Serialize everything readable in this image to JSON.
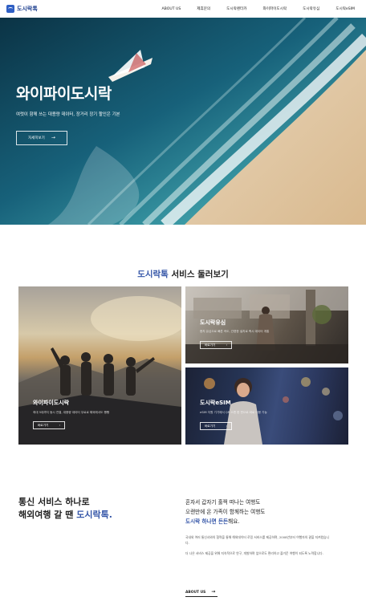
{
  "header": {
    "logo_text": "도시락톡",
    "nav": [
      "ABOUT US",
      "제휴문의",
      "도시락렌터카",
      "와이파이도시락",
      "도시락유심",
      "도시락eSIM"
    ]
  },
  "hero": {
    "title": "와이파이도시락",
    "subtitle": "여럿이 함께 쓰는 대용량 데이터, 장거리 장기 할인은 기본",
    "button_label": "자세히보기"
  },
  "services": {
    "title_highlight": "도시락톡",
    "title_rest": " 서비스 둘러보기",
    "cards": [
      {
        "name": "와이파이도시락",
        "desc": "최대 5대까지 동시 연결, 대용량 데이터 무료로 해외에서도 빵빵",
        "button_label": "바로가기"
      },
      {
        "name": "도시락유심",
        "desc": "현지 유심으로 빠른 속도, 간편한 설치로 즉시 데이터 개통",
        "button_label": "바로가기"
      },
      {
        "name": "도시락eSIM",
        "desc": "eSIM 지원 기기에서 QR 스캔 한 번으로 바로 이용 가능",
        "button_label": "바로가기"
      }
    ]
  },
  "about": {
    "headline_line1": "통신 서비스 하나로",
    "headline_line2_pre": "해외여행 갈 땐 ",
    "headline_highlight": "도시락톡.",
    "lead_line1": "혼자서 갑자기 훌쩍 떠나는 여행도",
    "lead_line2": "오랜만에 온 가족이 함께하는 여행도",
    "lead_line3_highlight": "도시락 하나면 든든",
    "lead_line3_rest": "해요.",
    "para1": "국내외 여러 통신사와의 협력을 통해 해외데이터 로밍 서비스를 제공하며, 2008년부터 여행자의 곁을 지켜왔습니다.",
    "para2": "더 나은 서비스 제공을 위해 지속적으로 연구, 개발하며 앞으로도 편리하고 즐거운 여행이 되도록 노력합니다.",
    "link_label": "ABOUT US"
  }
}
